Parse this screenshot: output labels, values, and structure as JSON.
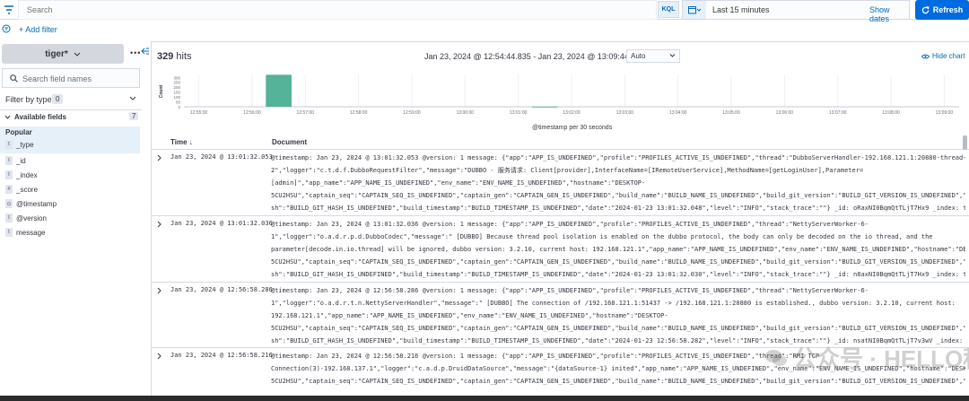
{
  "search": {
    "placeholder": "Search",
    "kql": "KQL"
  },
  "date": {
    "range": "Last 15 minutes",
    "show_dates": "Show dates",
    "refresh": "Refresh"
  },
  "filter": {
    "add_filter": "+ Add filter"
  },
  "sidebar": {
    "index_pattern": "tiger*",
    "field_search_placeholder": "Search field names",
    "filter_by_type": "Filter by type",
    "filter_count": "0",
    "available_fields": "Available fields",
    "available_count": "7",
    "popular": "Popular",
    "popular_fields": [
      {
        "type": "t",
        "name": "_type"
      }
    ],
    "fields": [
      {
        "type": "t",
        "name": "_id"
      },
      {
        "type": "t",
        "name": "_index"
      },
      {
        "type": "#",
        "name": "_score"
      },
      {
        "type": "⊙",
        "name": "@timestamp"
      },
      {
        "type": "t",
        "name": "@version"
      },
      {
        "type": "t",
        "name": "message"
      }
    ]
  },
  "main": {
    "hits_count": "329",
    "hits_label": "hits",
    "range_label": "Jan 23, 2024 @ 12:54:44.835 - Jan 23, 2024 @ 13:09:44.835",
    "interval": "Auto",
    "hide_chart": "Hide chart",
    "y_axis_label": "Count",
    "x_axis_label": "@timestamp per 30 seconds",
    "col_time": "Time ↓",
    "col_doc": "Document"
  },
  "chart_data": {
    "type": "bar",
    "ylabel": "Count",
    "xlabel": "@timestamp per 30 seconds",
    "ylim": [
      0,
      300
    ],
    "y_ticks": [
      "300",
      "250",
      "200",
      "150",
      "100",
      "50",
      "0"
    ],
    "x_ticks": [
      "12:55:00",
      "12:56:00",
      "12:57:00",
      "12:58:00",
      "12:59:00",
      "13:00:00",
      "13:01:00",
      "13:02:00",
      "13:03:00",
      "13:04:00",
      "13:05:00",
      "13:06:00",
      "13:07:00",
      "13:08:00",
      "13:09:00"
    ],
    "bars": [
      {
        "x": "12:56:30",
        "value": 327
      },
      {
        "x": "13:01:30",
        "value": 2
      }
    ]
  },
  "rows": [
    {
      "time": "Jan 23, 2024 @ 13:01:32.053",
      "lines": [
        "@timestamp: Jan 23, 2024 @ 13:01:32.053  @version: 1  message: {\"app\":\"APP_IS_UNDEFINED\",\"profile\":\"PROFILES_ACTIVE_IS_UNDEFINED\",\"thread\":\"DubboServerHandler-192.168.121.1:20880-thread-",
        "2\",\"logger\":\"c.t.d.f.DubboRequestFilter\",\"message\":\"DUBBO - 服务请求: Client[provider],InterfaceName=[IRemoteUserService],MethodName=[getLoginUser],Parameter=",
        "[admin]\",\"app_name\":\"APP_NAME_IS_UNDEFINED\",\"env_name\":\"ENV_NAME_IS_UNDEFINED\",\"hostname\":\"DESKTOP-",
        "5CU2HSU\",\"captain_seq\":\"CAPTAIN_SEQ_IS_UNDEFINED\",\"captain_gen\":\"CAPTAIN_GEN_IS_UNDEFINED\",\"build_name\":\"BUILD_NAME_IS_UNDEFINED\",\"build_git_version\":\"BUILD_GIT_VERSION_IS_UNDEFINED\",\"build_git_ha",
        "sh\":\"BUILD_GIT_HASH_IS_UNDEFINED\",\"build_timestamp\":\"BUILD_TIMESTAMP_IS_UNDEFINED\",\"date\":\"2024-01-23 13:01:32.048\",\"level\":\"INFO\",\"stack_trace\":\"\"}  _id: oRaxNI0BqmQtTLjT7Hx9  _index: tiger_logs"
      ]
    },
    {
      "time": "Jan 23, 2024 @ 13:01:32.036",
      "lines": [
        "@timestamp: Jan 23, 2024 @ 13:01:32.036  @version: 1  message: {\"app\":\"APP_IS_UNDEFINED\",\"profile\":\"PROFILES_ACTIVE_IS_UNDEFINED\",\"thread\":\"NettyServerWorker-6-",
        "1\",\"logger\":\"o.a.d.r.p.d.DubboCodec\",\"message\":\" [DUBBO] Because thread pool isolation is enabled on the dubbo protocol, the body can only be decoded on the io thread, and the",
        "parameter[decode.in.io.thread] will be ignored, dubbo version: 3.2.10, current host: 192.168.121.1\",\"app_name\":\"APP_NAME_IS_UNDEFINED\",\"env_name\":\"ENV_NAME_IS_UNDEFINED\",\"hostname\":\"DESKTOP-",
        "5CU2HSU\",\"captain_seq\":\"CAPTAIN_SEQ_IS_UNDEFINED\",\"captain_gen\":\"CAPTAIN_GEN_IS_UNDEFINED\",\"build_name\":\"BUILD_NAME_IS_UNDEFINED\",\"build_git_version\":\"BUILD_GIT_VERSION_IS_UNDEFINED\",\"build_git_ha",
        "sh\":\"BUILD_GIT_HASH_IS_UNDEFINED\",\"build_timestamp\":\"BUILD_TIMESTAMP_IS_UNDEFINED\",\"date\":\"2024-01-23 13:01:32.030\",\"level\":\"INFO\",\"stack_trace\":\"\"}  _id: n8axNI0BqmQtTLjT7Hx9  _index: tiger_logs"
      ]
    },
    {
      "time": "Jan 23, 2024 @ 12:56:58.286",
      "lines": [
        "@timestamp: Jan 23, 2024 @ 12:56:58.286  @version: 1  message: {\"app\":\"APP_IS_UNDEFINED\",\"profile\":\"PROFILES_ACTIVE_IS_UNDEFINED\",\"thread\":\"NettyServerWorker-6-",
        "1\",\"logger\":\"o.a.d.r.t.n.NettyServerHandler\",\"message\":\" [DUBBO] The connection of /192.168.121.1:51437 -> /192.168.121.1:20880 is established., dubbo version: 3.2.10, current host:",
        "192.168.121.1\",\"app_name\":\"APP_NAME_IS_UNDEFINED\",\"env_name\":\"ENV_NAME_IS_UNDEFINED\",\"hostname\":\"DESKTOP-",
        "5CU2HSU\",\"captain_seq\":\"CAPTAIN_SEQ_IS_UNDEFINED\",\"captain_gen\":\"CAPTAIN_GEN_IS_UNDEFINED\",\"build_name\":\"BUILD_NAME_IS_UNDEFINED\",\"build_git_version\":\"BUILD_GIT_VERSION_IS_UNDEFINED\",\"build_git_ha",
        "sh\":\"BUILD_GIT_HASH_IS_UNDEFINED\",\"build_timestamp\":\"BUILD_TIMESTAMP_IS_UNDEFINED\",\"date\":\"2024-01-23 12:56:58.282\",\"level\":\"INFO\",\"stack_trace\":\"\"}  _id: nsatNI0BqmQtTLjT7v3wV  _index: tiger_logs"
      ]
    },
    {
      "time": "Jan 23, 2024 @ 12:56:58.216",
      "lines": [
        "@timestamp: Jan 23, 2024 @ 12:56:58.216  @version: 1  message: {\"app\":\"APP_IS_UNDEFINED\",\"profile\":\"PROFILES_ACTIVE_IS_UNDEFINED\",\"thread\":\"RMI TCP",
        "Connection(3)-192.168.137.1\",\"logger\":\"c.a.d.p.DruidDataSource\",\"message\":\"{dataSource-1} inited\",\"app_name\":\"APP_NAME_IS_UNDEFINED\",\"env_name\":\"ENV_NAME_IS_UNDEFINED\",\"hostname\":\"DESKTOP-",
        "5CU2HSU\",\"captain_seq\":\"CAPTAIN_SEQ_IS_UNDEFINED\",\"captain_gen\":\"CAPTAIN_GEN_IS_UNDEFINED\",\"build_name\":\"BUILD_NAME_IS_UNDEFINED\",\"build_git_version\":\"BUILD_GIT_VERSION_IS_UNDEFINED\",\"build_git_ha"
      ]
    }
  ],
  "watermark": "公众号 · HELLO程序员"
}
